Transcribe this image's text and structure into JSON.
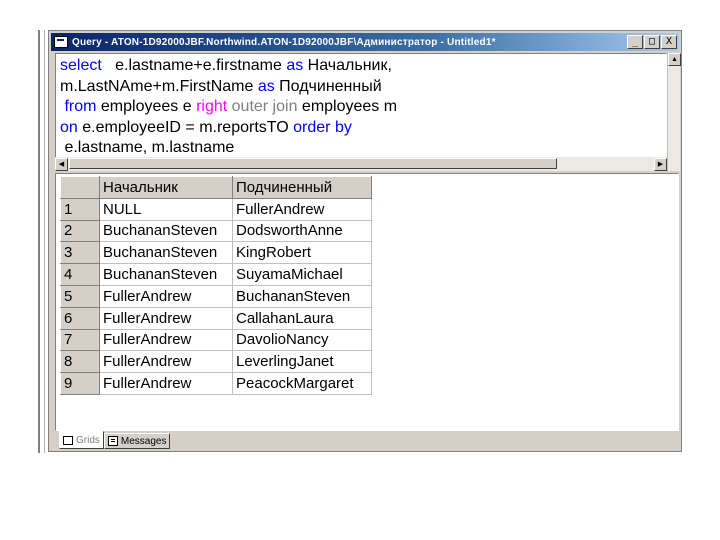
{
  "window": {
    "title": "Query - ATON-1D92000JBF.Northwind.ATON-1D92000JBF\\Администратор - Untitled1*",
    "buttons": [
      "_",
      "□",
      "X"
    ]
  },
  "query": {
    "lines": [
      [
        {
          "t": "select",
          "c": "kw"
        },
        {
          "t": "   e.lastname+e.firstname ",
          "c": "n"
        },
        {
          "t": "as",
          "c": "kw"
        },
        {
          "t": " Начальник,",
          "c": "n"
        }
      ],
      [
        {
          "t": "m.LastNAme+m.FirstName ",
          "c": "n"
        },
        {
          "t": "as",
          "c": "kw"
        },
        {
          "t": " Подчиненный",
          "c": "n"
        }
      ],
      [
        {
          "t": " from",
          "c": "kw"
        },
        {
          "t": " employees e ",
          "c": "n"
        },
        {
          "t": "right",
          "c": "pk"
        },
        {
          "t": " ",
          "c": "n"
        },
        {
          "t": "outer join",
          "c": "gr"
        },
        {
          "t": " employees m",
          "c": "n"
        }
      ],
      [
        {
          "t": "on",
          "c": "kw"
        },
        {
          "t": " e.employeeID = m.reportsTO ",
          "c": "n"
        },
        {
          "t": "order by",
          "c": "kw"
        }
      ],
      [
        {
          "t": " e.lastname, m.lastname",
          "c": "n"
        }
      ]
    ]
  },
  "results": {
    "columns": [
      "Начальник",
      "Подчиненный"
    ],
    "rows": [
      {
        "n": "1",
        "boss": "NULL",
        "sub": "FullerAndrew"
      },
      {
        "n": "2",
        "boss": "BuchananSteven",
        "sub": "DodsworthAnne"
      },
      {
        "n": "3",
        "boss": "BuchananSteven",
        "sub": "KingRobert"
      },
      {
        "n": "4",
        "boss": "BuchananSteven",
        "sub": "SuyamaMichael"
      },
      {
        "n": "5",
        "boss": "FullerAndrew",
        "sub": "BuchananSteven"
      },
      {
        "n": "6",
        "boss": "FullerAndrew",
        "sub": "CallahanLaura"
      },
      {
        "n": "7",
        "boss": "FullerAndrew",
        "sub": "DavolioNancy"
      },
      {
        "n": "8",
        "boss": "FullerAndrew",
        "sub": "LeverlingJanet"
      },
      {
        "n": "9",
        "boss": "FullerAndrew",
        "sub": "PeacockMargaret"
      }
    ]
  },
  "tabs": {
    "grids": "Grids",
    "messages": "Messages"
  },
  "colors": {
    "keyword": "#0000ff",
    "join_keyword": "#ff00ff",
    "outer_join": "#808080",
    "titlebar_start": "#0a246a",
    "chrome": "#d4d0c8"
  }
}
